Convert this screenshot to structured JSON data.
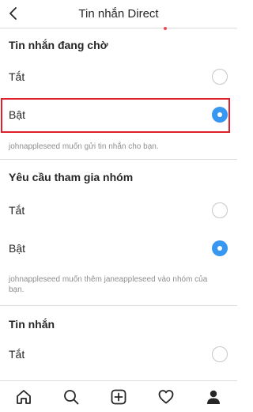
{
  "header": {
    "title": "Tin nhắn Direct",
    "back_icon": "chevron-left-icon"
  },
  "sections": [
    {
      "title": "Tin nhắn đang chờ",
      "options": [
        {
          "label": "Tắt",
          "selected": false
        },
        {
          "label": "Bật",
          "selected": true
        }
      ],
      "description": "johnappleseed muốn gửi tin nhắn cho bạn."
    },
    {
      "title": "Yêu cầu tham gia nhóm",
      "options": [
        {
          "label": "Tắt",
          "selected": false
        },
        {
          "label": "Bật",
          "selected": true
        }
      ],
      "description": "johnappleseed muốn thêm janeappleseed vào nhóm của bạn."
    },
    {
      "title": "Tin nhắn",
      "options": [
        {
          "label": "Tắt",
          "selected": false
        }
      ]
    }
  ],
  "tabbar": {
    "icons": [
      "home-icon",
      "search-icon",
      "new-post-icon",
      "activity-heart-icon",
      "profile-icon"
    ]
  },
  "colors": {
    "accent": "#3897f0",
    "highlight": "#e0202a",
    "notification": "#ed4956"
  }
}
